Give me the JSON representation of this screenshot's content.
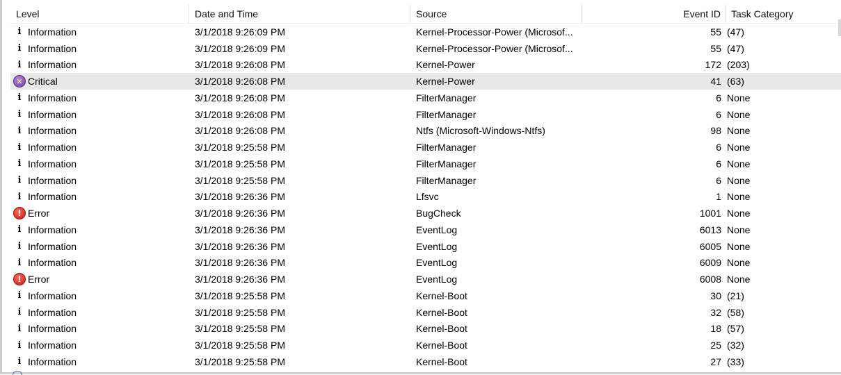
{
  "columns": {
    "level": "Level",
    "date_time": "Date and Time",
    "source": "Source",
    "event_id": "Event ID",
    "task_category": "Task Category"
  },
  "icons": {
    "information": "information-icon",
    "error": "error-icon",
    "critical": "critical-icon"
  },
  "events": [
    {
      "level": "Information",
      "type": "information",
      "date": "3/1/2018 9:26:09 PM",
      "source": "Kernel-Processor-Power (Microsof...",
      "id": "55",
      "task": "(47)"
    },
    {
      "level": "Information",
      "type": "information",
      "date": "3/1/2018 9:26:09 PM",
      "source": "Kernel-Processor-Power (Microsof...",
      "id": "55",
      "task": "(47)"
    },
    {
      "level": "Information",
      "type": "information",
      "date": "3/1/2018 9:26:08 PM",
      "source": "Kernel-Power",
      "id": "172",
      "task": "(203)"
    },
    {
      "level": "Critical",
      "type": "critical",
      "date": "3/1/2018 9:26:08 PM",
      "source": "Kernel-Power",
      "id": "41",
      "task": "(63)",
      "selected": true
    },
    {
      "level": "Information",
      "type": "information",
      "date": "3/1/2018 9:26:08 PM",
      "source": "FilterManager",
      "id": "6",
      "task": "None"
    },
    {
      "level": "Information",
      "type": "information",
      "date": "3/1/2018 9:26:08 PM",
      "source": "FilterManager",
      "id": "6",
      "task": "None"
    },
    {
      "level": "Information",
      "type": "information",
      "date": "3/1/2018 9:26:08 PM",
      "source": "Ntfs (Microsoft-Windows-Ntfs)",
      "id": "98",
      "task": "None"
    },
    {
      "level": "Information",
      "type": "information",
      "date": "3/1/2018 9:25:58 PM",
      "source": "FilterManager",
      "id": "6",
      "task": "None"
    },
    {
      "level": "Information",
      "type": "information",
      "date": "3/1/2018 9:25:58 PM",
      "source": "FilterManager",
      "id": "6",
      "task": "None"
    },
    {
      "level": "Information",
      "type": "information",
      "date": "3/1/2018 9:25:58 PM",
      "source": "FilterManager",
      "id": "6",
      "task": "None"
    },
    {
      "level": "Information",
      "type": "information",
      "date": "3/1/2018 9:26:36 PM",
      "source": "Lfsvc",
      "id": "1",
      "task": "None"
    },
    {
      "level": "Error",
      "type": "error",
      "date": "3/1/2018 9:26:36 PM",
      "source": "BugCheck",
      "id": "1001",
      "task": "None"
    },
    {
      "level": "Information",
      "type": "information",
      "date": "3/1/2018 9:26:36 PM",
      "source": "EventLog",
      "id": "6013",
      "task": "None"
    },
    {
      "level": "Information",
      "type": "information",
      "date": "3/1/2018 9:26:36 PM",
      "source": "EventLog",
      "id": "6005",
      "task": "None"
    },
    {
      "level": "Information",
      "type": "information",
      "date": "3/1/2018 9:26:36 PM",
      "source": "EventLog",
      "id": "6009",
      "task": "None"
    },
    {
      "level": "Error",
      "type": "error",
      "date": "3/1/2018 9:26:36 PM",
      "source": "EventLog",
      "id": "6008",
      "task": "None"
    },
    {
      "level": "Information",
      "type": "information",
      "date": "3/1/2018 9:25:58 PM",
      "source": "Kernel-Boot",
      "id": "30",
      "task": "(21)"
    },
    {
      "level": "Information",
      "type": "information",
      "date": "3/1/2018 9:25:58 PM",
      "source": "Kernel-Boot",
      "id": "32",
      "task": "(58)"
    },
    {
      "level": "Information",
      "type": "information",
      "date": "3/1/2018 9:25:58 PM",
      "source": "Kernel-Boot",
      "id": "18",
      "task": "(57)"
    },
    {
      "level": "Information",
      "type": "information",
      "date": "3/1/2018 9:25:58 PM",
      "source": "Kernel-Boot",
      "id": "25",
      "task": "(32)"
    },
    {
      "level": "Information",
      "type": "information",
      "date": "3/1/2018 9:25:58 PM",
      "source": "Kernel-Boot",
      "id": "27",
      "task": "(33)"
    }
  ]
}
